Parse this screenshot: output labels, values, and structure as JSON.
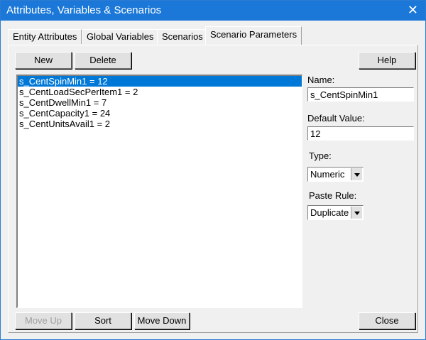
{
  "window": {
    "title": "Attributes, Variables & Scenarios",
    "close_glyph": "✕"
  },
  "tabs": [
    {
      "label": "Entity Attributes"
    },
    {
      "label": "Global Variables"
    },
    {
      "label": "Scenarios"
    },
    {
      "label": "Scenario Parameters",
      "active": true
    }
  ],
  "toolbar": {
    "new_label": "New",
    "delete_label": "Delete",
    "help_label": "Help"
  },
  "list": {
    "items": [
      "s_CentSpinMin1 = 12",
      "s_CentLoadSecPerItem1 = 2",
      "s_CentDwellMin1 = 7",
      "s_CentCapacity1 = 24",
      "s_CentUnitsAvail1 = 2"
    ],
    "selected_index": 0
  },
  "fields": {
    "name_label": "Name:",
    "name_value": "s_CentSpinMin1",
    "default_label": "Default Value:",
    "default_value": "12",
    "type_label": "Type:",
    "type_value": "Numeric",
    "paste_label": "Paste Rule:",
    "paste_value": "Duplicate"
  },
  "footer": {
    "move_up_label": "Move Up",
    "sort_label": "Sort",
    "move_down_label": "Move Down",
    "close_label": "Close"
  }
}
